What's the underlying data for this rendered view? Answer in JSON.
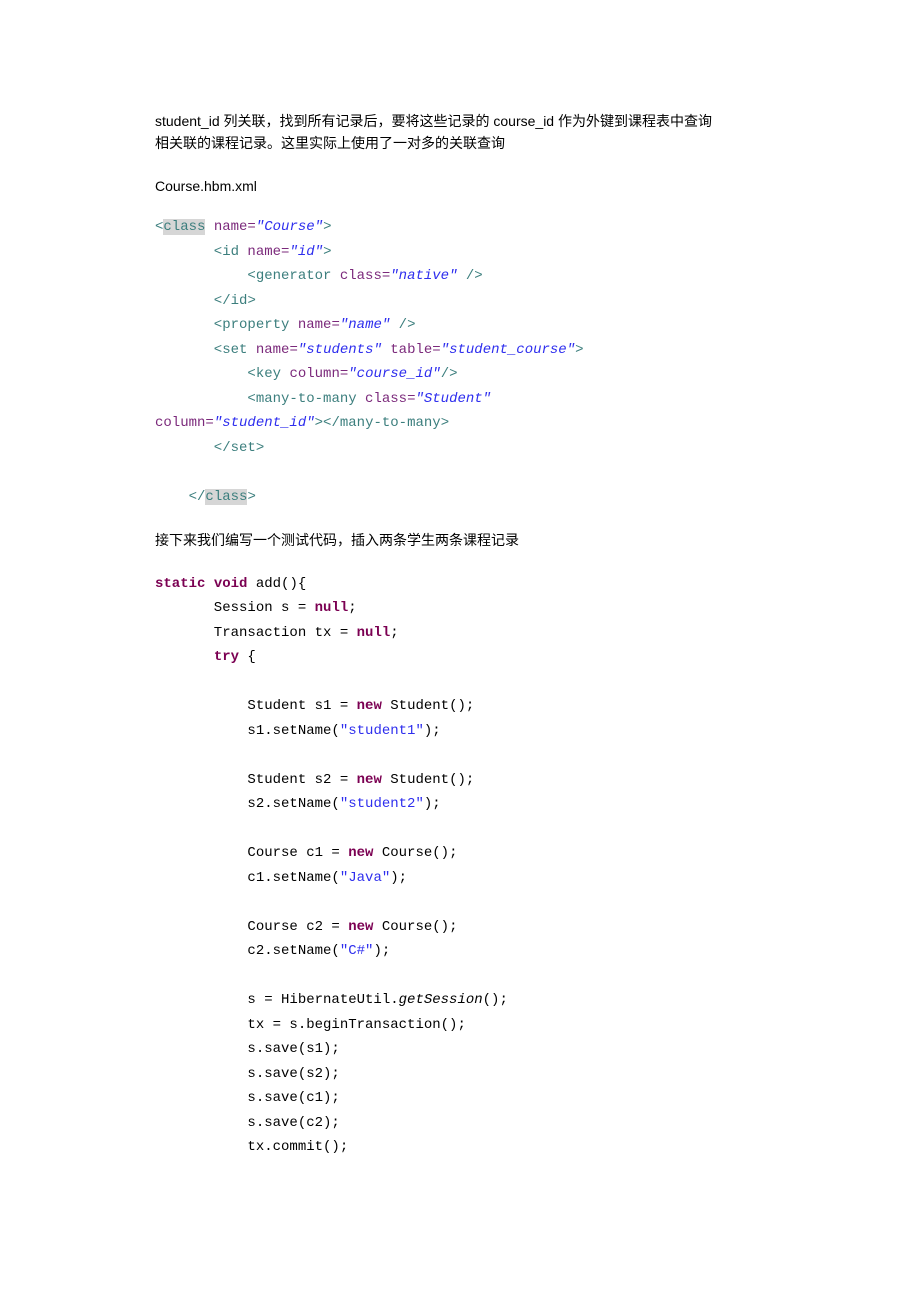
{
  "intro_line1_a": "student_id 列关联，找到所有记录后，要将这些记录的 course_id 作为外键到课程表中查询",
  "intro_line2": "相关联的课程记录。这里实际上使用了一对多的关联查询",
  "filename": "Course.hbm.xml",
  "xml": {
    "l1_open": "<",
    "l1_kw": "class",
    "l1_attr": " name=",
    "l1_val": "\"Course\"",
    "l1_close": ">",
    "l2_open": "       <",
    "l2_tag": "id",
    "l2_attr": " name=",
    "l2_val": "\"id\"",
    "l2_close": ">",
    "l3_open": "           <",
    "l3_tag": "generator",
    "l3_attr": " class=",
    "l3_val": "\"native\"",
    "l3_close": " />",
    "l4_open": "       </",
    "l4_tag": "id",
    "l4_close": ">",
    "l5_open": "       <",
    "l5_tag": "property",
    "l5_attr": " name=",
    "l5_val": "\"name\"",
    "l5_close": " />",
    "l6_open": "       <",
    "l6_tag": "set",
    "l6_attr1": " name=",
    "l6_val1": "\"students\"",
    "l6_attr2": " table=",
    "l6_val2": "\"student_course\"",
    "l6_close": ">",
    "l7_open": "           <",
    "l7_tag": "key",
    "l7_attr": " column=",
    "l7_val": "\"course_id\"",
    "l7_close": "/>",
    "l8_open": "           <",
    "l8_tag": "many-to-many",
    "l8_attr": " class=",
    "l8_val": "\"Student\"",
    "l9_attr": "column=",
    "l9_val": "\"student_id\"",
    "l9_close": "></",
    "l9_tag": "many-to-many",
    "l9_close2": ">",
    "l10_open": "       </",
    "l10_tag": "set",
    "l10_close": ">",
    "l11_open": "    </",
    "l11_kw": "class",
    "l11_close": ">"
  },
  "mid_para": "接下来我们编写一个测试代码，插入两条学生两条课程记录",
  "java": {
    "l1_a": "static",
    "l1_b": " void",
    "l1_c": " add(){",
    "l2_a": "       Session s = ",
    "l2_b": "null",
    "l2_c": ";",
    "l3_a": "       Transaction tx = ",
    "l3_b": "null",
    "l3_c": ";",
    "l4_a": "       ",
    "l4_b": "try",
    "l4_c": " {",
    "blank": "",
    "l5_a": "           Student s1 = ",
    "l5_b": "new",
    "l5_c": " Student();",
    "l6_a": "           s1.setName(",
    "l6_b": "\"student1\"",
    "l6_c": ");",
    "l7_a": "           Student s2 = ",
    "l7_b": "new",
    "l7_c": " Student();",
    "l8_a": "           s2.setName(",
    "l8_b": "\"student2\"",
    "l8_c": ");",
    "l9_a": "           Course c1 = ",
    "l9_b": "new",
    "l9_c": " Course();",
    "l10_a": "           c1.setName(",
    "l10_b": "\"Java\"",
    "l10_c": ");",
    "l11_a": "           Course c2 = ",
    "l11_b": "new",
    "l11_c": " Course();",
    "l12_a": "           c2.setName(",
    "l12_b": "\"C#\"",
    "l12_c": ");",
    "l13_a": "           s = HibernateUtil.",
    "l13_b": "getSession",
    "l13_c": "();",
    "l14": "           tx = s.beginTransaction();",
    "l15": "           s.save(s1);",
    "l16": "           s.save(s2);",
    "l17": "           s.save(c1);",
    "l18": "           s.save(c2);",
    "l19": "           tx.commit();"
  }
}
